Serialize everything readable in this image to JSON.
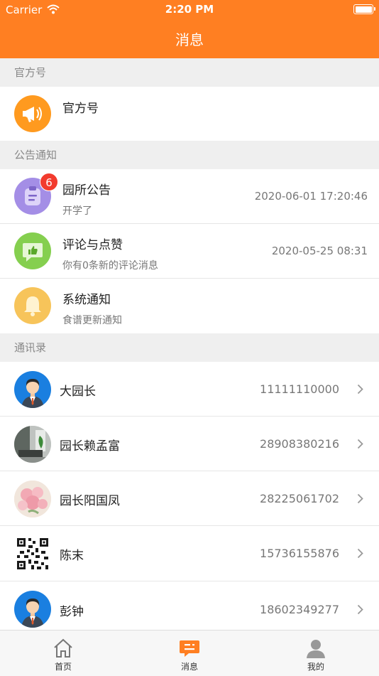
{
  "status_bar": {
    "carrier": "Carrier",
    "time": "2:20 PM"
  },
  "header": {
    "title": "消息"
  },
  "sections": {
    "official": "官方号",
    "notices": "公告通知",
    "contacts": "通讯录"
  },
  "official_row": {
    "name": "官方号",
    "icon": "megaphone-icon",
    "color": "#ff9a1f"
  },
  "notice_rows": [
    {
      "name": "园所公告",
      "subtitle": "开学了",
      "time": "2020-06-01 17:20:46",
      "badge": "6",
      "icon": "notice-board-icon",
      "color": "#a48ee6"
    },
    {
      "name": "评论与点赞",
      "subtitle": "你有0条新的评论消息",
      "time": "2020-05-25 08:31",
      "icon": "like-comment-icon",
      "color": "#85cf4f"
    },
    {
      "name": "系统通知",
      "subtitle": "食谱更新通知",
      "icon": "bell-icon",
      "color": "#f7c45a"
    }
  ],
  "contacts": [
    {
      "name": "大园长",
      "phone": "11111110000",
      "avatar": "avatar-man-cartoon"
    },
    {
      "name": "园长赖孟富",
      "phone": "28908380216",
      "avatar": "avatar-room-photo"
    },
    {
      "name": "园长阳国凤",
      "phone": "28225061702",
      "avatar": "avatar-flowers-photo"
    },
    {
      "name": "陈末",
      "phone": "15736155876",
      "avatar": "avatar-qr-code"
    },
    {
      "name": "彭钟",
      "phone": "18602349277",
      "avatar": "avatar-man-cartoon"
    }
  ],
  "tabbar": [
    {
      "label": "首页",
      "icon": "home-icon",
      "active": false
    },
    {
      "label": "消息",
      "icon": "message-icon",
      "active": true
    },
    {
      "label": "我的",
      "icon": "profile-icon",
      "active": false
    }
  ],
  "colors": {
    "header": "#ff7f22",
    "accent": "#ff7f22",
    "badge": "#f23b2e"
  }
}
